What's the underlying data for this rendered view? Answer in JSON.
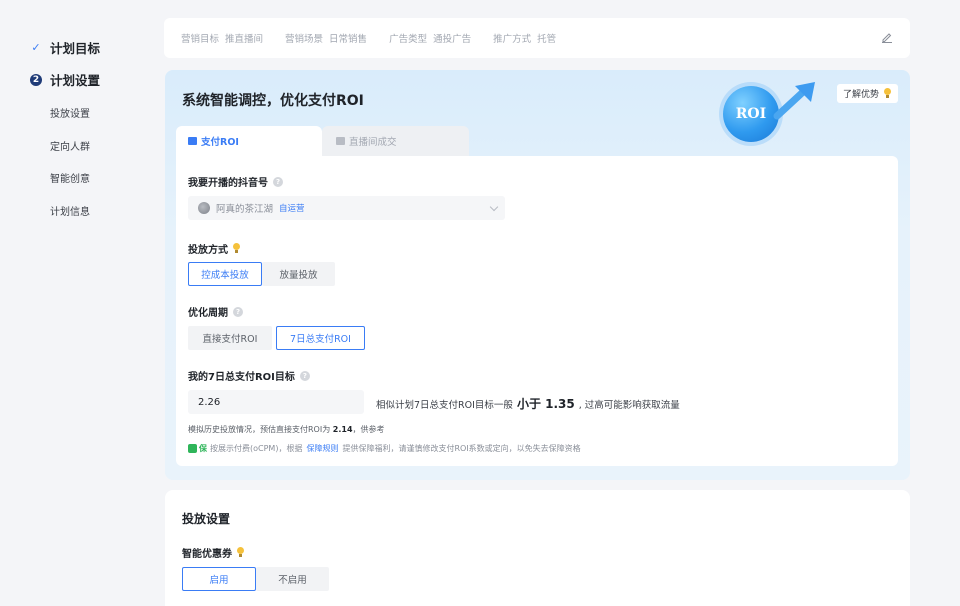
{
  "sidebar": {
    "steps": [
      {
        "label": "计划目标",
        "state": "done"
      },
      {
        "label": "计划设置",
        "state": "current",
        "number": "2"
      }
    ],
    "subitems": [
      "投放设置",
      "定向人群",
      "智能创意",
      "计划信息"
    ]
  },
  "summary": {
    "items": [
      {
        "key": "营销目标",
        "value": "推直播间"
      },
      {
        "key": "营销场景",
        "value": "日常销售"
      },
      {
        "key": "广告类型",
        "value": "通投广告"
      },
      {
        "key": "推广方式",
        "value": "托管"
      }
    ],
    "edit_icon": "pencil-icon"
  },
  "roi": {
    "title": "系统智能调控，优化支付ROI",
    "learn_more": "了解优势",
    "badge": "ROI",
    "tabs": [
      {
        "label": "支付ROI",
        "active": true
      },
      {
        "label": "直播间成交",
        "active": false
      }
    ],
    "account": {
      "label": "我要开播的抖音号",
      "name": "阿真的茶江湖",
      "tag": "自运营"
    },
    "delivery_mode": {
      "label": "投放方式",
      "options": [
        "控成本投放",
        "放量投放"
      ],
      "selected": "控成本投放"
    },
    "period": {
      "label": "优化周期",
      "options": [
        "直接支付ROI",
        "7日总支付ROI"
      ],
      "selected": "7日总支付ROI"
    },
    "target": {
      "label": "我的7日总支付ROI目标",
      "value": "2.26",
      "hint_before": "相似计划7日总支付ROI目标一般",
      "hint_strong": "小于 1.35",
      "hint_after": ", 过高可能影响获取流量"
    },
    "estimate": {
      "before": "模拟历史投放情况，预估直接支付ROI为",
      "value": "2.14",
      "after": "，供参考"
    },
    "guarantee": {
      "tag": "保",
      "before": "按展示付费(oCPM)，根据",
      "link": "保障规则",
      "after": "提供保障福利，请谨慎修改支付ROI系数或定向，以免失去保障资格"
    }
  },
  "delivery": {
    "title": "投放设置",
    "coupon_label": "智能优惠券",
    "options": [
      "启用",
      "不启用"
    ],
    "selected": "启用"
  },
  "colors": {
    "accent": "#3a7cf5",
    "success": "#2fb55a"
  }
}
